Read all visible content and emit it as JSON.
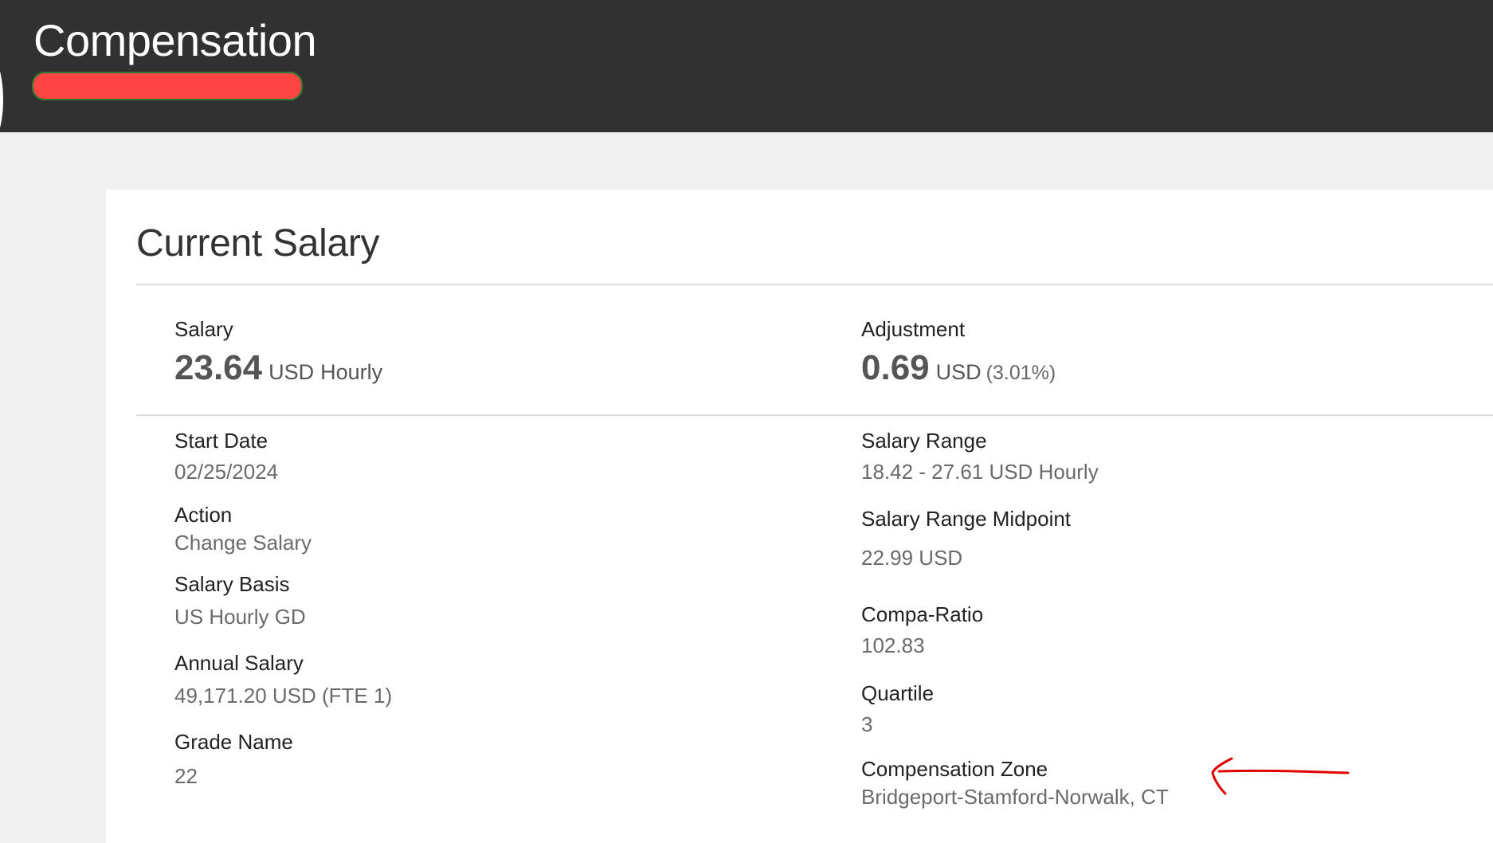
{
  "header": {
    "title": "Compensation"
  },
  "section": {
    "title": "Current Salary"
  },
  "summary": {
    "salary": {
      "label": "Salary",
      "amount": "23.64",
      "currency": "USD",
      "basis": "Hourly"
    },
    "adjustment": {
      "label": "Adjustment",
      "amount": "0.69",
      "currency": "USD",
      "percent": "(3.01%)"
    }
  },
  "details_left": [
    {
      "label": "Start Date",
      "value": "02/25/2024"
    },
    {
      "label": "Action",
      "value": "Change Salary"
    },
    {
      "label": "Salary Basis",
      "value": "US Hourly GD"
    },
    {
      "label": "Annual Salary",
      "value": "49,171.20 USD (FTE 1)"
    },
    {
      "label": "Grade Name",
      "value": "22"
    }
  ],
  "details_right": [
    {
      "label": "Salary Range",
      "value": "18.42 - 27.61 USD Hourly"
    },
    {
      "label": "Salary Range Midpoint",
      "value": "22.99 USD"
    },
    {
      "label": "Compa-Ratio",
      "value": "102.83"
    },
    {
      "label": "Quartile",
      "value": "3"
    },
    {
      "label": "Compensation Zone",
      "value": "Bridgeport-Stamford-Norwalk, CT"
    }
  ],
  "colors": {
    "header_bg": "#313131",
    "page_bg": "#f1f1f1",
    "redaction": "#ff4444",
    "annotation_arrow": "#e00000"
  },
  "icons": {
    "annotation": "red-arrow-icon"
  }
}
